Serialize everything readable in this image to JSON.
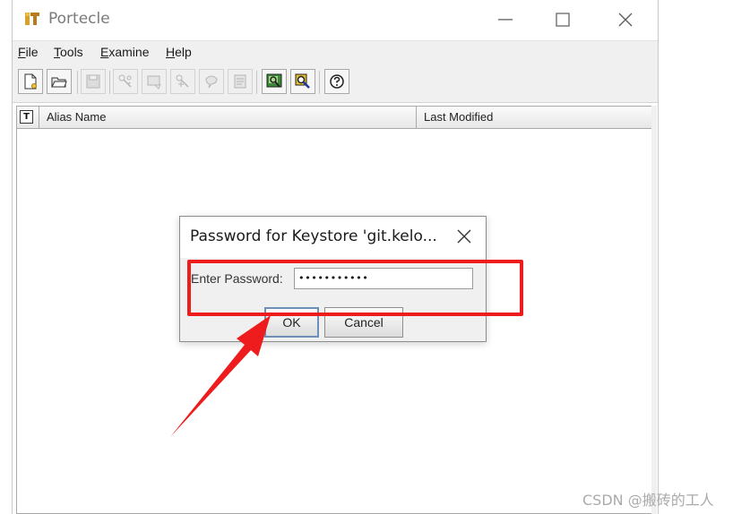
{
  "window": {
    "title": "Portecle"
  },
  "menubar": {
    "items": [
      {
        "label": "File",
        "mnemonic": "F",
        "rest": "ile"
      },
      {
        "label": "Tools",
        "mnemonic": "T",
        "rest": "ools"
      },
      {
        "label": "Examine",
        "mnemonic": "E",
        "rest": "xamine"
      },
      {
        "label": "Help",
        "mnemonic": "H",
        "rest": "elp"
      }
    ]
  },
  "toolbar": {
    "buttons": [
      {
        "icon": "new-keystore-icon",
        "enabled": true
      },
      {
        "icon": "open-keystore-icon",
        "enabled": true
      },
      {
        "icon": "save-keystore-icon",
        "enabled": false
      },
      {
        "icon": "generate-keypair-icon",
        "enabled": false
      },
      {
        "icon": "import-trusted-cert-icon",
        "enabled": false
      },
      {
        "icon": "import-keypair-icon",
        "enabled": false
      },
      {
        "icon": "keystore-password-icon",
        "enabled": false
      },
      {
        "icon": "keystore-report-icon",
        "enabled": false
      },
      {
        "icon": "examine-certificate-icon",
        "enabled": true
      },
      {
        "icon": "examine-crl-icon",
        "enabled": true
      },
      {
        "icon": "help-icon",
        "enabled": true
      }
    ]
  },
  "table": {
    "type_header": "T",
    "columns": [
      "Alias Name",
      "Last Modified"
    ]
  },
  "dialog": {
    "title": "Password for Keystore 'git.kelo...",
    "password_label": "Enter Password:",
    "password_value": "•••••••••••",
    "ok_label": "OK",
    "cancel_label": "Cancel"
  },
  "annotation": {
    "color": "#ee1c1c"
  },
  "watermark": "CSDN @搬砖的工人"
}
